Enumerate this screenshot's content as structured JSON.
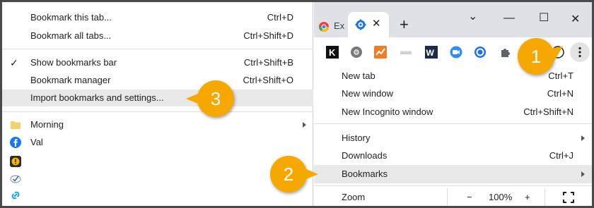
{
  "bookmarks_menu": {
    "items": [
      {
        "label": "Bookmark this tab...",
        "shortcut": "Ctrl+D"
      },
      {
        "label": "Bookmark all tabs...",
        "shortcut": "Ctrl+Shift+D"
      },
      {
        "label": "Show bookmarks bar",
        "shortcut": "Ctrl+Shift+B"
      },
      {
        "label": "Bookmark manager",
        "shortcut": "Ctrl+Shift+O"
      },
      {
        "label": "Import bookmarks and settings...",
        "shortcut": ""
      }
    ],
    "folders": [
      {
        "label": "Morning"
      },
      {
        "label": "Val"
      }
    ]
  },
  "chrome": {
    "tab1_label": "Ex",
    "new_tab_symbol": "+",
    "window_controls": {
      "minimize": "—",
      "maximize": "☐",
      "close": "✕",
      "tabsearch": "⌄"
    },
    "toolbar_icons": [
      "k-extension-icon",
      "chrome-icon",
      "analytics-icon",
      "bar-icon",
      "w-icon",
      "zoom-icon",
      "c-icon",
      "puzzle-icon",
      "profile-icon",
      "kebab-menu-icon"
    ],
    "menu": {
      "items": [
        {
          "label": "New tab",
          "shortcut": "Ctrl+T"
        },
        {
          "label": "New window",
          "shortcut": "Ctrl+N"
        },
        {
          "label": "New Incognito window",
          "shortcut": "Ctrl+Shift+N"
        },
        {
          "label": "History",
          "shortcut": ""
        },
        {
          "label": "Downloads",
          "shortcut": "Ctrl+J"
        },
        {
          "label": "Bookmarks",
          "shortcut": ""
        },
        {
          "label": "Zoom",
          "shortcut": ""
        }
      ],
      "zoom": {
        "minus": "−",
        "value": "100%",
        "plus": "+"
      }
    }
  },
  "callouts": [
    "1",
    "2",
    "3"
  ],
  "colors": {
    "callout": "#f6a800",
    "highlight": "#e8e8e8"
  }
}
